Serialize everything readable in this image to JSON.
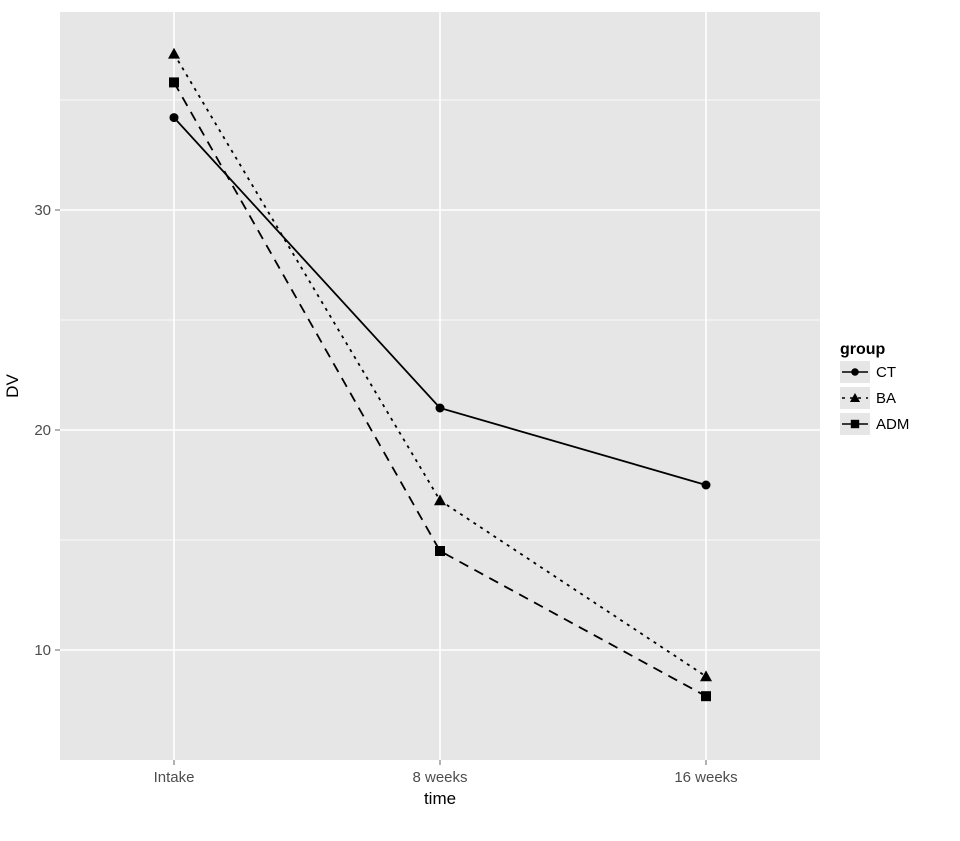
{
  "chart_data": {
    "type": "line",
    "title": "",
    "xlabel": "time",
    "ylabel": "DV",
    "categories": [
      "Intake",
      "8 weeks",
      "16 weeks"
    ],
    "y_ticks": [
      10,
      20,
      30
    ],
    "ylim": [
      5,
      39
    ],
    "legend_title": "group",
    "series": [
      {
        "name": "CT",
        "values": [
          34.2,
          21.0,
          17.5
        ],
        "dash": "solid",
        "marker": "circle"
      },
      {
        "name": "BA",
        "values": [
          37.1,
          16.8,
          8.8
        ],
        "dash": "dot",
        "marker": "triangle"
      },
      {
        "name": "ADM",
        "values": [
          35.8,
          14.5,
          7.9
        ],
        "dash": "dash",
        "marker": "square"
      }
    ]
  },
  "colors": {
    "panel_bg": "#e6e6e6",
    "grid": "#ffffff",
    "ink": "#000000",
    "axis_text": "#4d4d4d",
    "axis_title": "#000000"
  }
}
